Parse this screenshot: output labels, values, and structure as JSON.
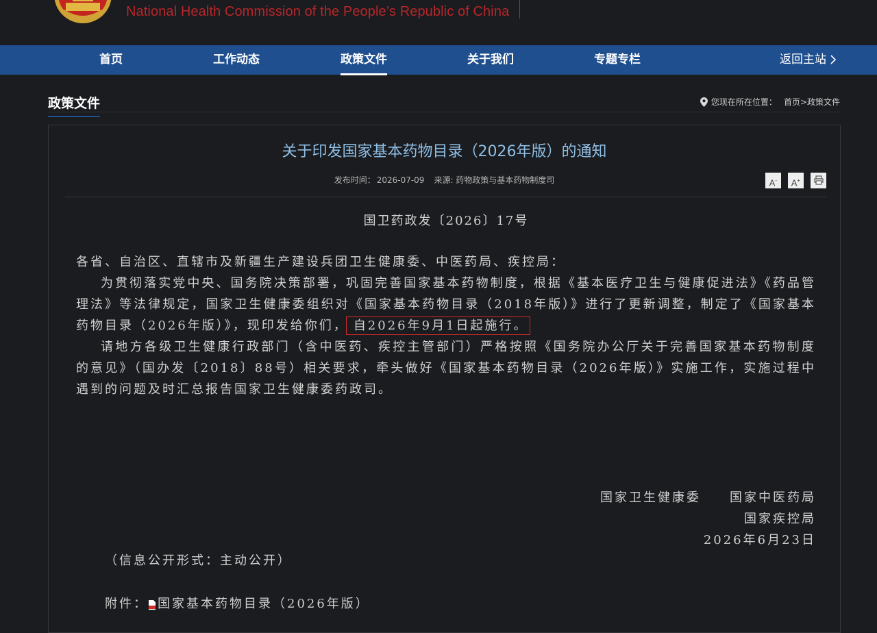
{
  "header": {
    "site_name_en": "National Health Commission of the People’s  Republic of China"
  },
  "nav": {
    "items": [
      "首页",
      "工作动态",
      "政策文件",
      "关于我们",
      "专题专栏"
    ],
    "active": "政策文件",
    "back": "返回主站"
  },
  "section": {
    "title": "政策文件",
    "location_label": "您现在所在位置：",
    "breadcrumb": "首页>政策文件"
  },
  "article": {
    "title": "关于印发国家基本药物目录（2026年版）的通知",
    "publish_label": "发布时间：",
    "publish_date": "2026-07-09",
    "source": "来源: 药物政策与基本药物制度司",
    "tools": [
      "A-",
      "A+",
      "print"
    ],
    "doc_number": "国卫药政发〔2026〕17号",
    "salutation": "各省、自治区、直辖市及新疆生产建设兵团卫生健康委、中医药局、疾控局：",
    "para1": "为贯彻落实党中央、国务院决策部署，巩固完善国家基本药物制度，根据《基本医疗卫生与健康促进法》《药品管理法》等法律规定，国家卫生健康委组织对《国家基本药物目录（2018年版）》进行了更新调整，制定了《国家基本药物目录（2026年版）》，现印发给你们，",
    "para1_highlight": "自2026年9月1日起施行。",
    "para2": "请地方各级卫生健康行政部门（含中医药、疾控主管部门）严格按照《国务院办公厅关于完善国家基本药物制度的意见》（国办发〔2018〕88号）相关要求，牵头做好《国家基本药物目录（2026年版）》实施工作，实施过程中遇到的问题及时汇总报告国家卫生健康委药政司。",
    "signatures": [
      "国家卫生健康委　　国家中医药局",
      "国家疾控局",
      "2026年6月23日"
    ],
    "open_form": "（信息公开形式：主动公开）",
    "attachment_label": "附件：",
    "attachment_name": "国家基本药物目录（2026年版）"
  },
  "colors": {
    "nav_bg": "#1f4f8e",
    "title": "#8fbfe6",
    "highlight_box": "#d42b2b",
    "brand_red": "#b8262a"
  }
}
